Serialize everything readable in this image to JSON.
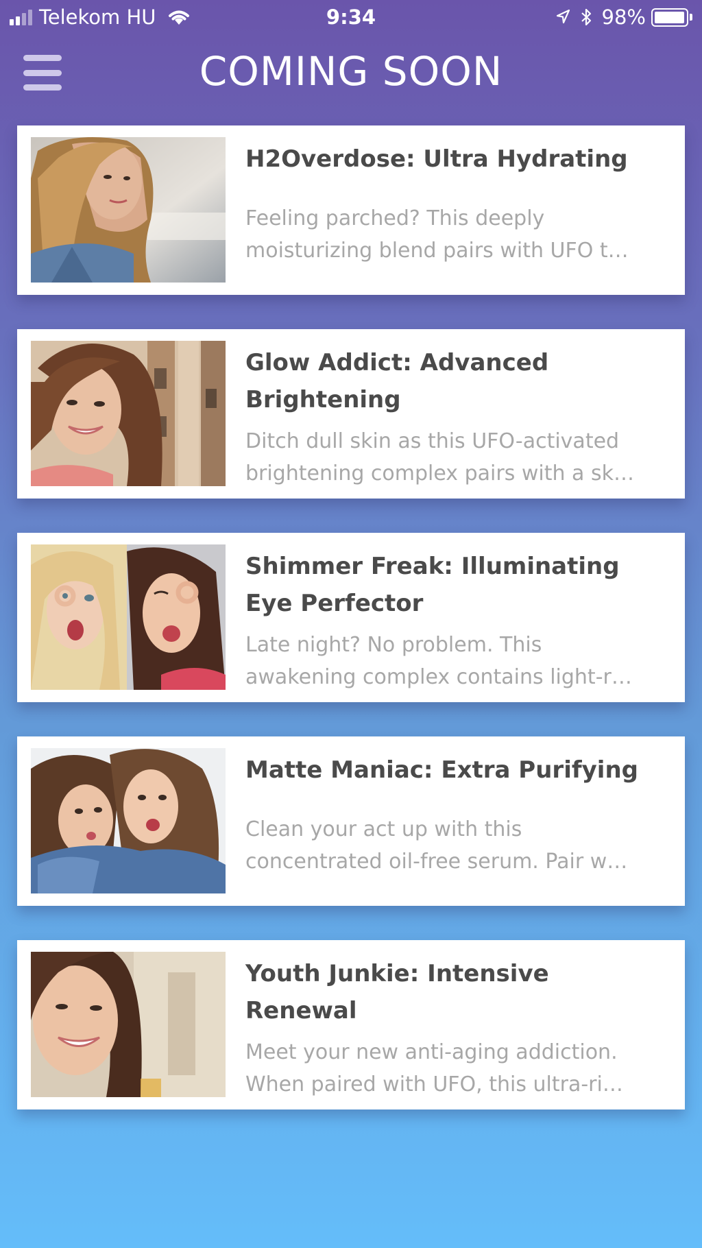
{
  "status_bar": {
    "carrier": "Telekom HU",
    "time": "9:34",
    "battery": "98%",
    "battery_level": 0.98
  },
  "header": {
    "title": "COMING SOON",
    "menu_icon": "hamburger-icon"
  },
  "colors": {
    "gradient_top": "#6a55ab",
    "gradient_bottom": "#64bdfa",
    "card_background": "#ffffff",
    "title_text": "#4a4a4a",
    "description_text": "#a7a7a7"
  },
  "products": [
    {
      "title": "H2Overdose: Ultra Hydrating",
      "desc_line1": "Feeling parched? This deeply",
      "desc_line2": "moisturizing blend pairs with UFO t…",
      "image": "woman-blonde-portrait-photo"
    },
    {
      "title": "Glow Addict: Advanced Brightening",
      "desc_line1": "Ditch dull skin as this UFO-activated",
      "desc_line2": "brightening complex pairs with a sk…",
      "image": "woman-smiling-street-photo"
    },
    {
      "title": "Shimmer Freak: Illuminating Eye Perfector",
      "desc_line1": "Late night? No problem. This",
      "desc_line2": "awakening complex contains light-r…",
      "image": "two-women-ok-gesture-photo"
    },
    {
      "title": "Matte Maniac: Extra Purifying",
      "desc_line1": "Clean your act up with this",
      "desc_line2": "concentrated oil-free serum. Pair w…",
      "image": "two-women-hugging-photo"
    },
    {
      "title": "Youth Junkie: Intensive Renewal",
      "desc_line1": "Meet your new anti-aging addiction.",
      "desc_line2": "When paired with UFO, this ultra-ri…",
      "image": "woman-smiling-closeup-photo"
    }
  ]
}
